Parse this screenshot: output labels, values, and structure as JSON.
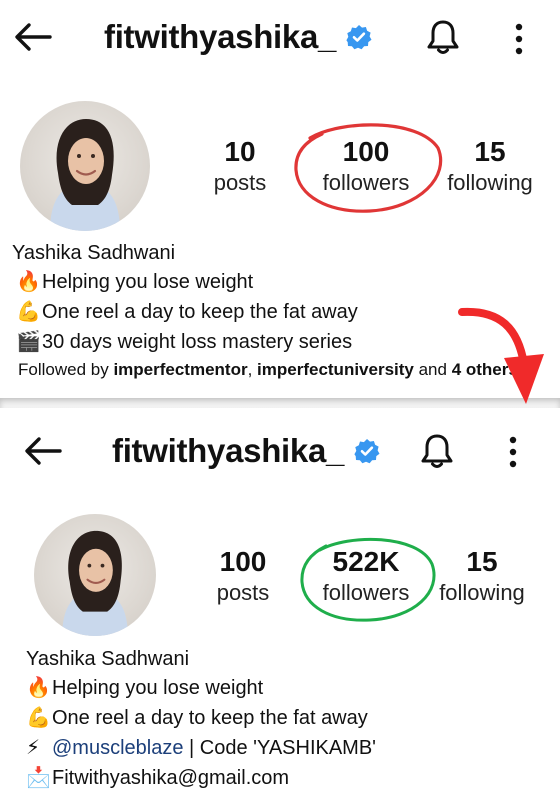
{
  "top": {
    "username": "fitwithyashika_",
    "stats": [
      {
        "value": "10",
        "label": "posts"
      },
      {
        "value": "100",
        "label": "followers"
      },
      {
        "value": "15",
        "label": "following"
      }
    ],
    "name": "Yashika Sadhwani",
    "bio": [
      {
        "emoji": "🔥",
        "text": "Helping you lose weight"
      },
      {
        "emoji": "💪",
        "text": "One reel a day to keep the fat away"
      },
      {
        "emoji": "🎬",
        "text": "30 days weight loss mastery series"
      }
    ],
    "followed_by": {
      "prefix": "Followed by ",
      "user1": "imperfectmentor",
      "sep": ", ",
      "user2": "imperfectuniversity",
      "and": " and ",
      "others": "4 others"
    }
  },
  "bottom": {
    "username": "fitwithyashika_",
    "stats": [
      {
        "value": "100",
        "label": "posts"
      },
      {
        "value": "522K",
        "label": "followers"
      },
      {
        "value": "15",
        "label": "following"
      }
    ],
    "name": "Yashika Sadhwani",
    "bio": [
      {
        "emoji": "🔥",
        "text": "Helping you lose weight"
      },
      {
        "emoji": "💪",
        "text": "One reel a day to keep the fat away"
      }
    ],
    "bio_link_line": {
      "emoji": "⚡",
      "link": "@muscleblaze",
      "text": " | Code 'YASHIKAMB'"
    },
    "email_line": {
      "emoji": "📩",
      "text": "Fitwithyashika@gmail.com"
    }
  },
  "colors": {
    "verified": "#3897f0",
    "red_circle": "#e03636",
    "green_circle": "#1fae4b",
    "arrow": "#f02a2a",
    "link": "#1c3f7a"
  }
}
